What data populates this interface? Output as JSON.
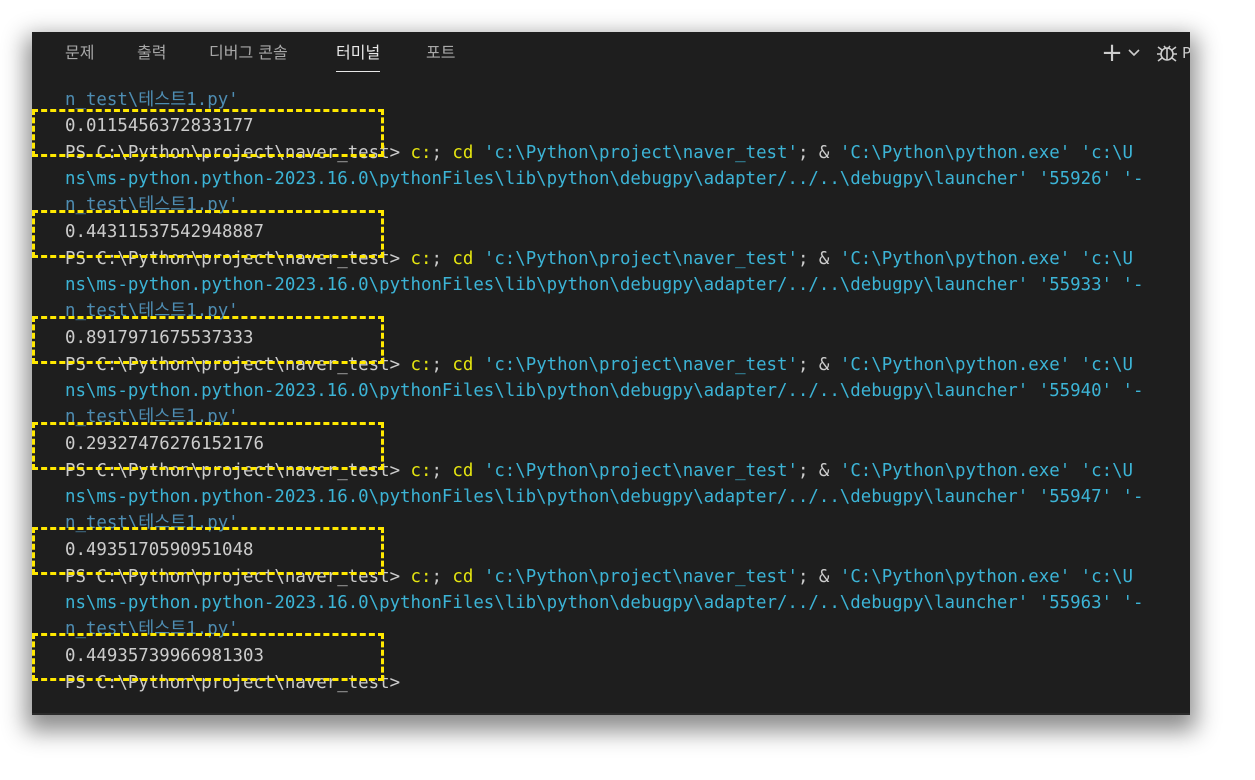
{
  "tabs": [
    {
      "label": "문제"
    },
    {
      "label": "출력"
    },
    {
      "label": "디버그 콘솔"
    },
    {
      "label": "터미널"
    },
    {
      "label": "포트"
    }
  ],
  "actions": {
    "add_label": "+",
    "overflow_letter": "P"
  },
  "icons": {
    "add": "plus-icon",
    "dropdown": "chevron-down-icon",
    "debug": "bug-icon"
  },
  "colors": {
    "background": "#1e1e1e",
    "accent_blue": "#3b9fd6",
    "command_yellow": "#e5e510",
    "highlight": "#ffe800"
  },
  "terminal": {
    "file_fragment": "n_test\\테스트1.py'",
    "prompt": "PS C:\\Python\\project\\naver_test> ",
    "cmd_c": "c:",
    "cmd_sep": "; ",
    "cmd_cd": "cd",
    "cmd_path": " 'c:\\Python\\project\\naver_test'",
    "cmd_amp": "; & ",
    "cmd_exe": "'C:\\Python\\python.exe' ",
    "cmd_tail": "'c:\\U",
    "launcher_line_pre": "ns\\ms-python.python-2023.16.0\\pythonFiles\\lib\\python\\debugpy\\adapter/../..\\debugpy\\launcher' ",
    "ports": [
      "'55926'",
      "'55933'",
      "'55940'",
      "'55947'",
      "'55963'"
    ],
    "port_tail": " '-",
    "outputs": [
      "0.0115456372833177",
      "0.44311537542948887",
      "0.8917971675537333",
      "0.29327476276152176",
      "0.4935170590951048",
      "0.44935739966981303"
    ]
  }
}
